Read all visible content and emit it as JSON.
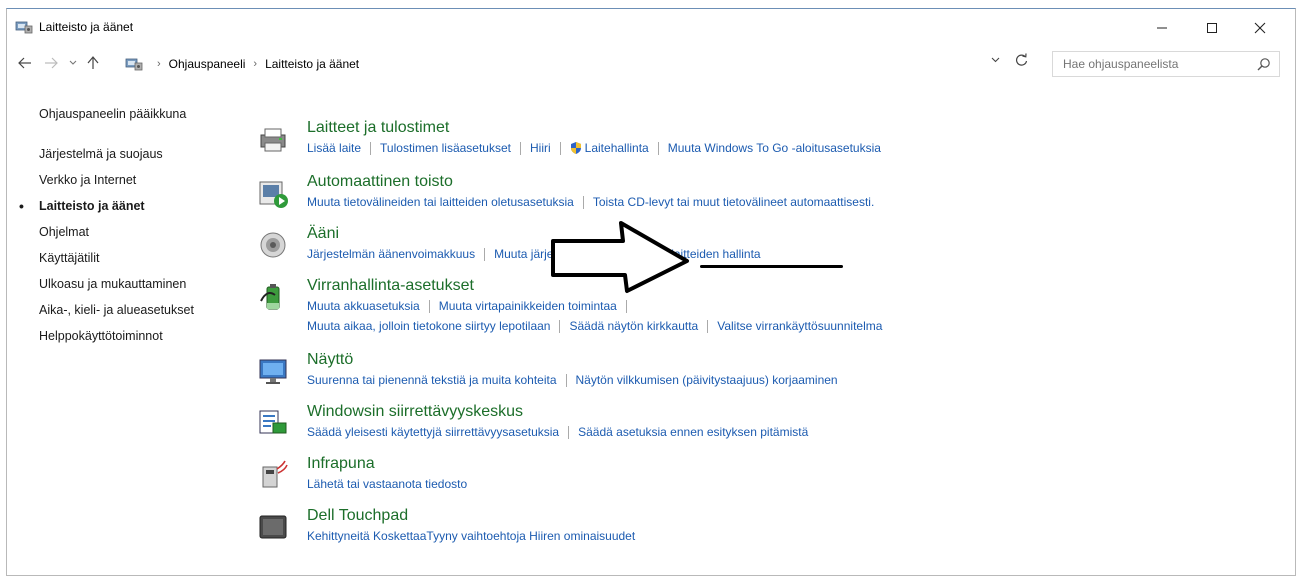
{
  "window": {
    "title": "Laitteisto ja äänet",
    "controls": {
      "minimize": "minimize",
      "maximize": "maximize",
      "close": "close"
    }
  },
  "address": {
    "breadcrumb": [
      "Ohjauspaneeli",
      "Laitteisto ja äänet"
    ],
    "search_placeholder": "Hae ohjauspaneelista"
  },
  "sidebar": {
    "items": [
      {
        "label": "Ohjauspaneelin pääikkuna",
        "active": false
      },
      {
        "label": "Järjestelmä ja suojaus",
        "active": false
      },
      {
        "label": "Verkko ja Internet",
        "active": false
      },
      {
        "label": "Laitteisto ja äänet",
        "active": true
      },
      {
        "label": "Ohjelmat",
        "active": false
      },
      {
        "label": "Käyttäjätilit",
        "active": false
      },
      {
        "label": "Ulkoasu ja mukauttaminen",
        "active": false
      },
      {
        "label": "Aika-, kieli- ja alueasetukset",
        "active": false
      },
      {
        "label": "Helppokäyttötoiminnot",
        "active": false
      }
    ]
  },
  "categories": [
    {
      "title": "Laitteet ja tulostimet",
      "icon": "printer-icon",
      "rows": [
        [
          "Lisää laite",
          "Tulostimen lisäasetukset",
          "Hiiri",
          "Laitehallinta",
          "Muuta Windows To Go -aloitusasetuksia"
        ]
      ]
    },
    {
      "title": "Automaattinen toisto",
      "icon": "autoplay-icon",
      "rows": [
        [
          "Muuta tietovälineiden tai laitteiden oletusasetuksia",
          "Toista CD-levyt tai muut tietovälineet automaattisesti."
        ]
      ]
    },
    {
      "title": "Ääni",
      "icon": "speaker-icon",
      "rows": [
        [
          "Järjestelmän äänenvoimakkuus",
          "Muuta järjestelmän ääniä",
          "Äänilaitteiden hallinta"
        ]
      ]
    },
    {
      "title": "Virranhallinta-asetukset",
      "icon": "battery-icon",
      "rows": [
        [
          "Muuta akkuasetuksia",
          "Muuta virtapainikkeiden toimintaa"
        ],
        [
          "Muuta aikaa, jolloin tietokone siirtyy lepotilaan",
          "Säädä näytön kirkkautta",
          "Valitse virrankäyttösuunnitelma"
        ]
      ]
    },
    {
      "title": "Näyttö",
      "icon": "monitor-icon",
      "rows": [
        [
          "Suurenna tai pienennä tekstiä ja muita kohteita",
          "Näytön vilkkumisen (päivitystaajuus) korjaaminen"
        ]
      ]
    },
    {
      "title": "Windowsin siirrettävyyskeskus",
      "icon": "mobility-center-icon",
      "rows": [
        [
          "Säädä yleisesti käytettyjä siirrettävyysasetuksia",
          "Säädä asetuksia ennen esityksen pitämistä"
        ]
      ]
    },
    {
      "title": "Infrapuna",
      "icon": "infrared-icon",
      "rows": [
        [
          "Lähetä tai vastaanota tiedosto"
        ]
      ]
    },
    {
      "title": "Dell Touchpad",
      "icon": "touchpad-icon",
      "rows": [
        [
          "Kehittyneitä KoskettaaTyyny vaihtoehtoja Hiiren ominaisuudet"
        ]
      ]
    }
  ],
  "colors": {
    "link": "#1c5bb0",
    "category_title": "#1c6e2a",
    "annotation": "#000000"
  }
}
